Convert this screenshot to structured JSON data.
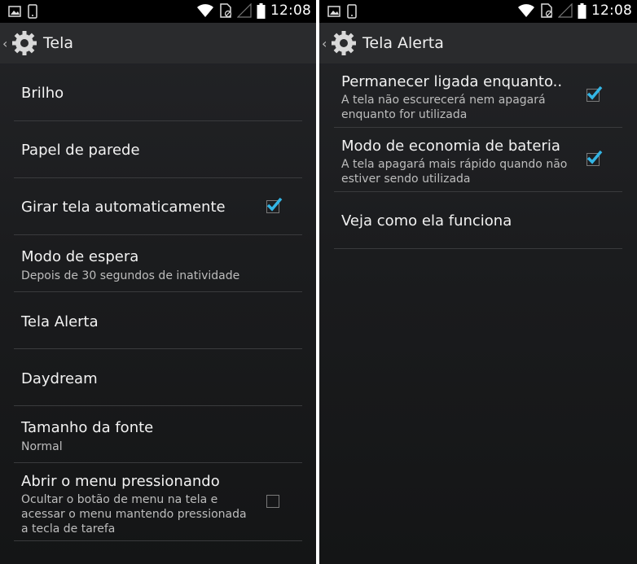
{
  "status_bar": {
    "time": "12:08"
  },
  "left_screen": {
    "title": "Tela",
    "items": [
      {
        "title": "Brilho"
      },
      {
        "title": "Papel de parede"
      },
      {
        "title": "Girar tela automaticamente",
        "checked": true
      },
      {
        "title": "Modo de espera",
        "summary": "Depois de 30 segundos de inatividade"
      },
      {
        "title": "Tela Alerta"
      },
      {
        "title": "Daydream"
      },
      {
        "title": "Tamanho da fonte",
        "summary": "Normal"
      },
      {
        "title": "Abrir o menu pressionando",
        "summary_lines": [
          "Ocultar o botão de menu na tela e",
          "acessar o menu mantendo pressionada",
          "a tecla de tarefa"
        ],
        "checked": false
      }
    ]
  },
  "right_screen": {
    "title": "Tela Alerta",
    "items": [
      {
        "title": "Permanecer ligada enquanto..",
        "summary_lines": [
          "A tela não escurecerá nem apagará",
          "enquanto for utilizada"
        ],
        "checked": true
      },
      {
        "title": "Modo de economia de bateria",
        "summary_lines": [
          "A tela apagará mais rápido quando não",
          "estiver sendo utilizada"
        ],
        "checked": true
      },
      {
        "title": "Veja como ela funciona"
      }
    ]
  },
  "colors": {
    "accent": "#33b5e5",
    "background": "#1b1c1e",
    "divider": "#3a3b3d"
  },
  "icons": [
    "image-icon",
    "phone-icon",
    "wifi-icon",
    "no-sim-icon",
    "signal-icon",
    "battery-icon",
    "gear-icon",
    "back-chevron-icon",
    "checkbox-icon"
  ]
}
